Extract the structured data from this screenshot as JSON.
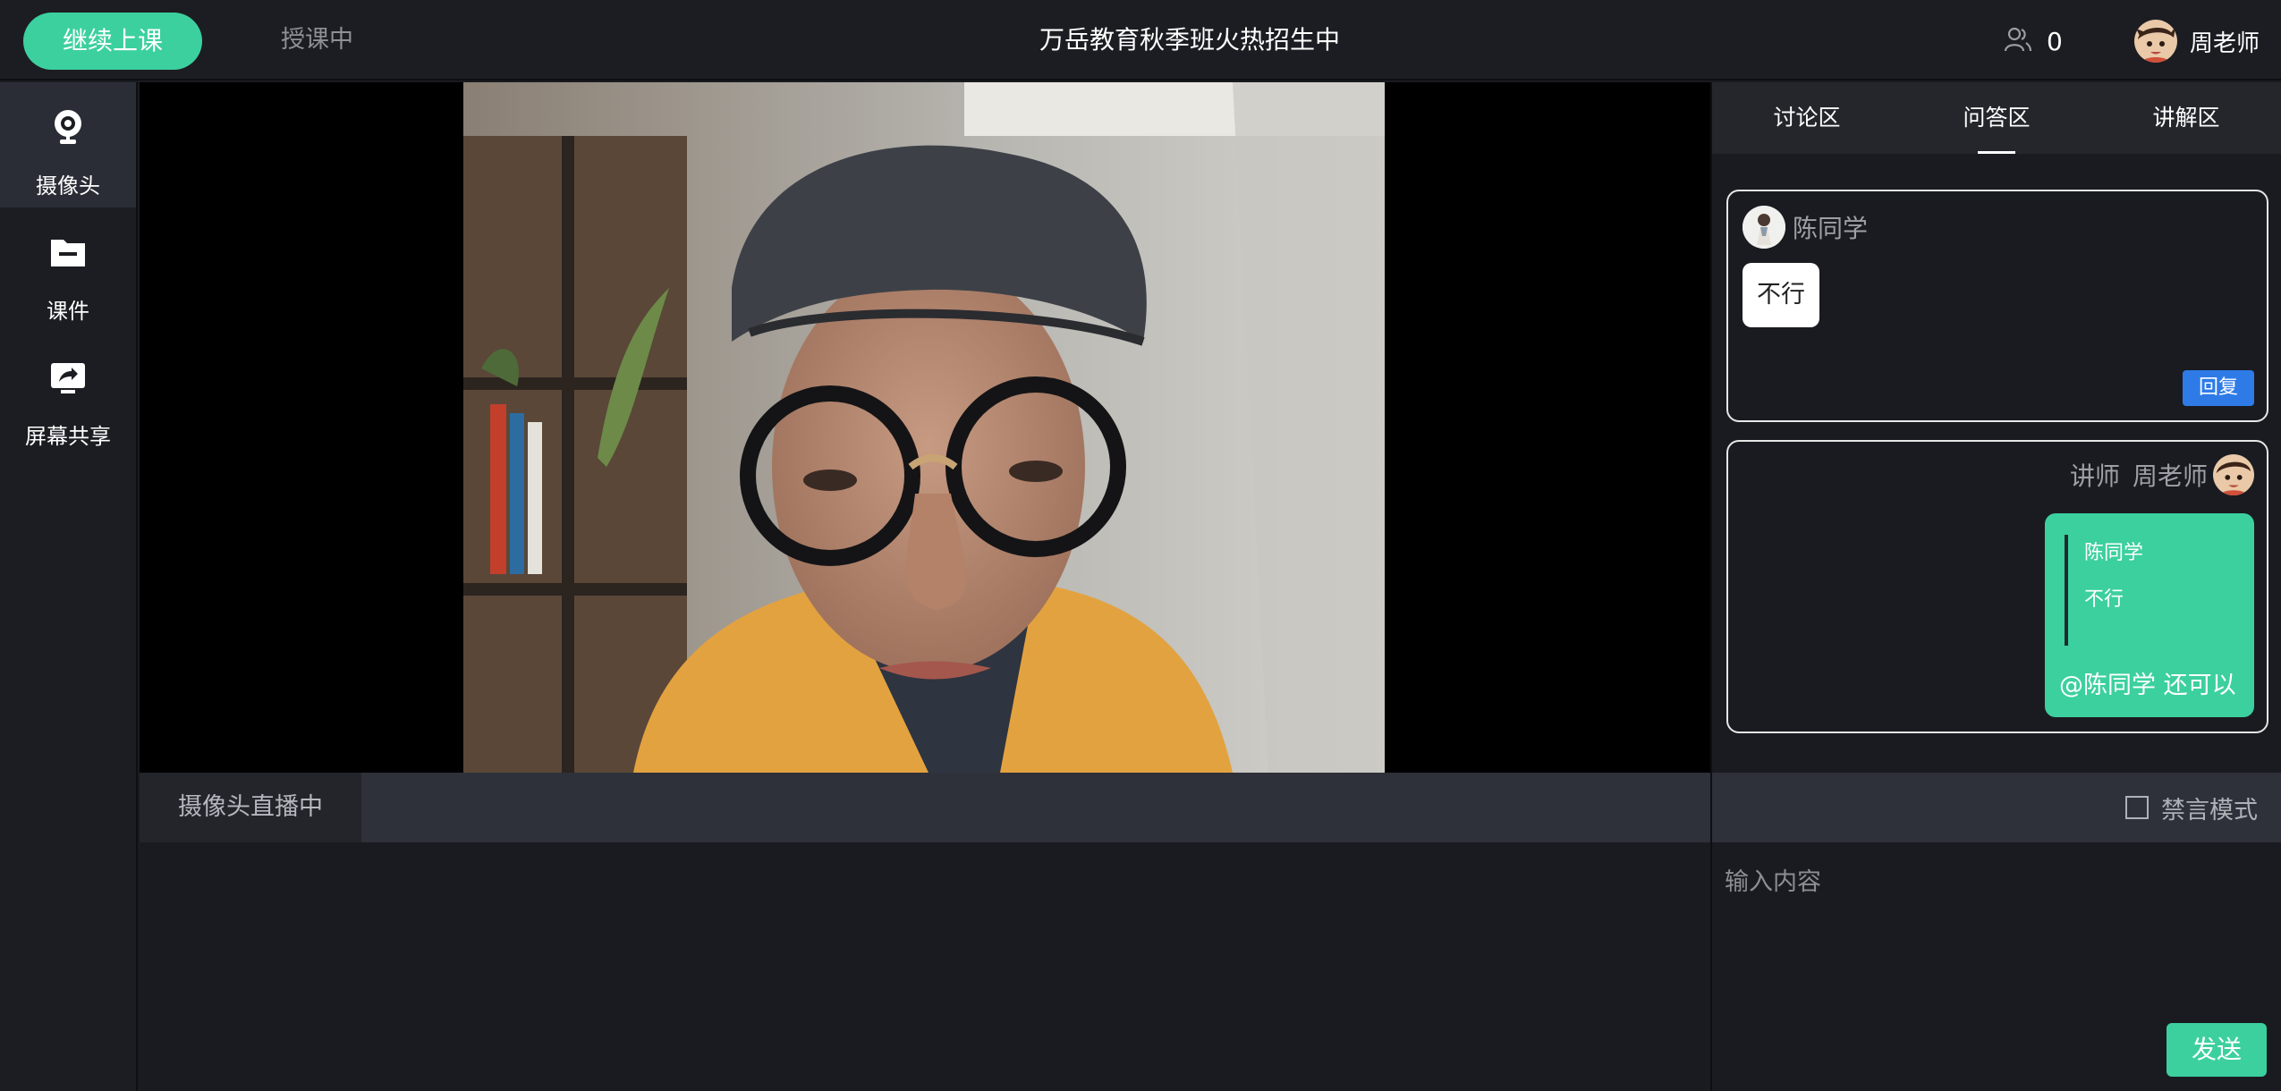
{
  "topbar": {
    "continue_label": "继续上课",
    "status_label": "授课中",
    "title": "万岳教育秋季班火热招生中",
    "online_count": "0",
    "teacher_name": "周老师",
    "icons": {
      "online": "people-icon",
      "avatar": "teacher-avatar"
    }
  },
  "sidebar": {
    "items": [
      {
        "label": "摄像头",
        "icon": "webcam-icon",
        "active": true
      },
      {
        "label": "课件",
        "icon": "folder-icon",
        "active": false
      },
      {
        "label": "屏幕共享",
        "icon": "screen-share-icon",
        "active": false
      }
    ]
  },
  "video": {
    "live_tab_label": "摄像头直播中"
  },
  "right_panel": {
    "tabs": [
      {
        "label": "讨论区",
        "active": false
      },
      {
        "label": "问答区",
        "active": true
      },
      {
        "label": "讲解区",
        "active": false
      }
    ],
    "question": {
      "student_name": "陈同学",
      "text": "不行",
      "reply_label": "回复"
    },
    "answer": {
      "role": "讲师",
      "teacher_name": "周老师",
      "quote_name": "陈同学",
      "quote_text": "不行",
      "reply": "@陈同学 还可以"
    }
  },
  "input": {
    "mute_label": "禁言模式",
    "mute_checked": false,
    "placeholder": "输入内容",
    "send_label": "发送"
  },
  "colors": {
    "accent": "#3cd09f",
    "reply_button": "#2e7be8",
    "background": "#1a1b20",
    "bar": "#2e3139"
  }
}
